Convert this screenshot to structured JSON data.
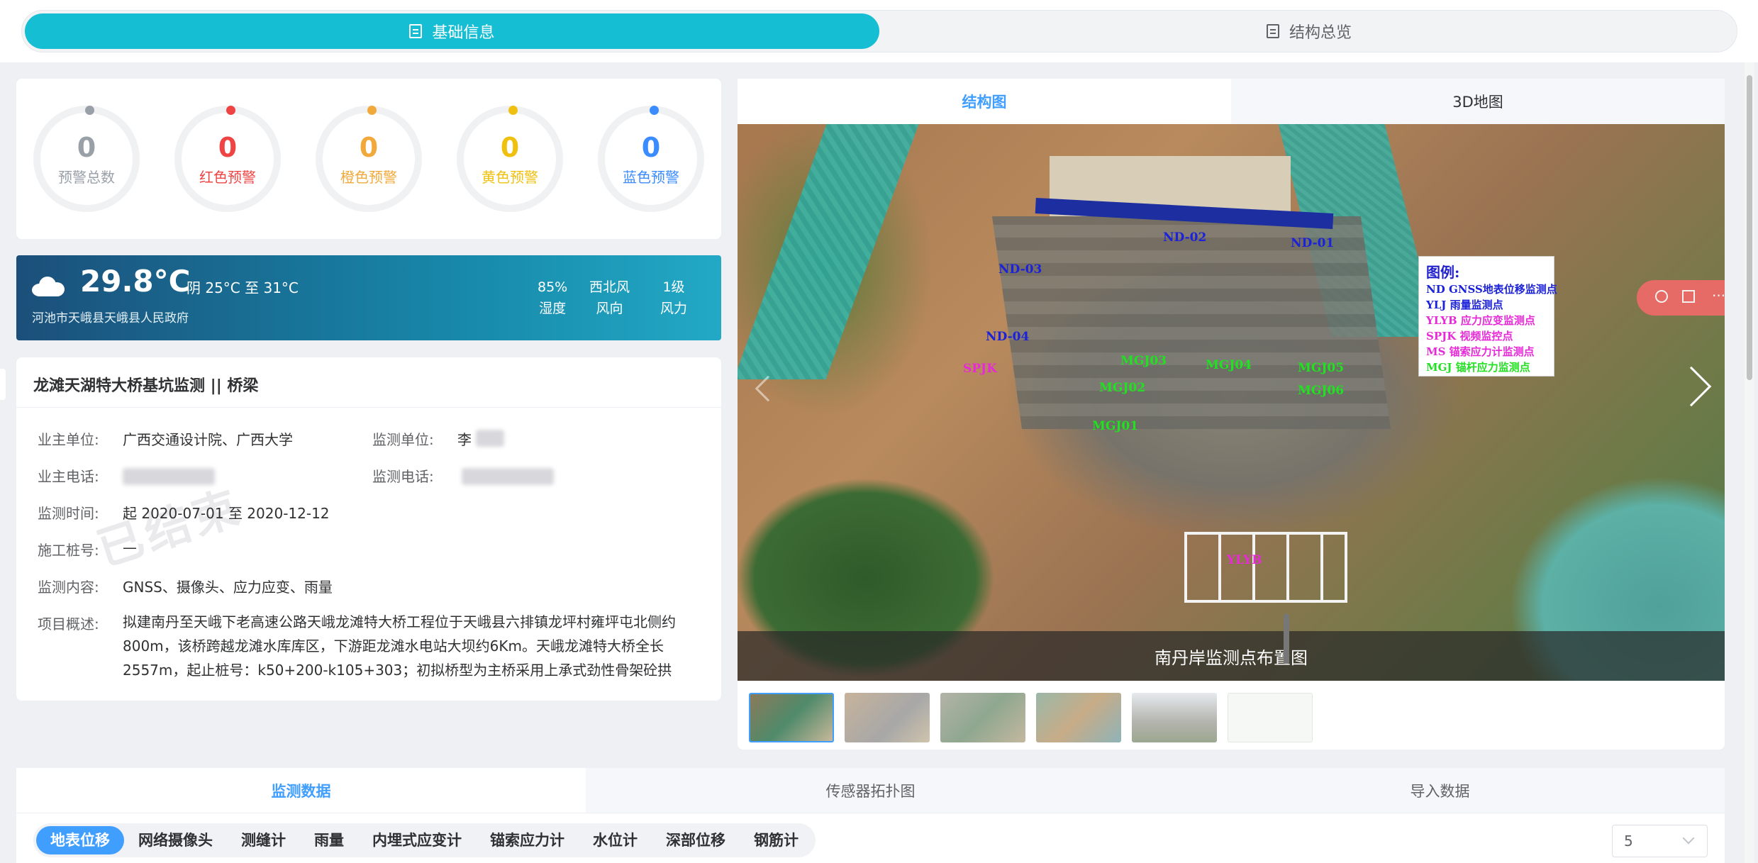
{
  "top_tabs": [
    "基础信息",
    "结构总览"
  ],
  "alarms": [
    {
      "value": "0",
      "label": "预警总数",
      "color": "#9aa0a8"
    },
    {
      "value": "0",
      "label": "红色预警",
      "color": "#ef4444"
    },
    {
      "value": "0",
      "label": "橙色预警",
      "color": "#f2a93b"
    },
    {
      "value": "0",
      "label": "黄色预警",
      "color": "#f0c010"
    },
    {
      "value": "0",
      "label": "蓝色预警",
      "color": "#3b8cff"
    }
  ],
  "weather": {
    "temp": "29.8°C",
    "desc": "阴 25°C 至 31°C",
    "location": "河池市天峨县天峨县人民政府",
    "stats": [
      {
        "value": "85%",
        "label": "湿度"
      },
      {
        "value": "西北风",
        "label": "风向"
      },
      {
        "value": "1级",
        "label": "风力"
      }
    ]
  },
  "project": {
    "title": "龙滩天湖特大桥基坑监测 || 桥梁",
    "stamp": "已结束",
    "fields": {
      "owner_label": "业主单位:",
      "owner": "广西交通设计院、广西大学",
      "monitor_unit_label": "监测单位:",
      "monitor_unit": "李",
      "owner_phone_label": "业主电话:",
      "monitor_phone_label": "监测电话:",
      "time_label": "监测时间:",
      "time": "起 2020-07-01 至 2020-12-12",
      "pile_label": "施工桩号:",
      "pile": "—",
      "content_label": "监测内容:",
      "content": "GNSS、摄像头、应力应变、雨量",
      "summary_label": "项目概述:",
      "summary": "拟建南丹至天峨下老高速公路天峨龙滩特大桥工程位于天峨县六排镇龙坪村雍坪屯北侧约800m，该桥跨越龙滩水库库区，下游距龙滩水电站大坝约6Km。天峨龙滩特大桥全长2557m，起止桩号：k50+200-k105+303；初拟桥型为主桥采用上承式劲性骨架砼拱桥..."
    }
  },
  "view_tabs": [
    "结构图",
    "3D地图"
  ],
  "photo": {
    "caption": "南丹岸监测点布置图",
    "markers": {
      "nd01": "ND-01",
      "nd02": "ND-02",
      "nd03": "ND-03",
      "nd04": "ND-04",
      "spjk": "SPJK",
      "mgj01": "MGJ01",
      "mgj02": "MGJ02",
      "mgj03": "MGJ03",
      "mgj04": "MGJ04",
      "mgj05": "MGJ05",
      "mgj06": "MGJ06",
      "ylyb": "YLYB"
    },
    "legend": {
      "title": "图例:",
      "rows": [
        {
          "code": "ND",
          "text": "GNSS地表位移监测点",
          "color": "#1c22d8"
        },
        {
          "code": "YLJ",
          "text": "雨量监测点",
          "color": "#1c22d8"
        },
        {
          "code": "YLYB",
          "text": "应力应变监测点",
          "color": "#e829d8"
        },
        {
          "code": "SPJK",
          "text": "视频监控点",
          "color": "#e829d8"
        },
        {
          "code": "MS",
          "text": "锚索应力计监测点",
          "color": "#e829d8"
        },
        {
          "code": "MGJ",
          "text": "锚杆应力监测点",
          "color": "#22e022"
        }
      ]
    }
  },
  "bottom_tabs": [
    "监测数据",
    "传感器拓扑图",
    "导入数据"
  ],
  "sensor_tabs": [
    "地表位移",
    "网络摄像头",
    "测缝计",
    "雨量",
    "内埋式应变计",
    "锚索应力计",
    "水位计",
    "深部位移",
    "钢筋计"
  ],
  "page_size": {
    "value": "5"
  }
}
